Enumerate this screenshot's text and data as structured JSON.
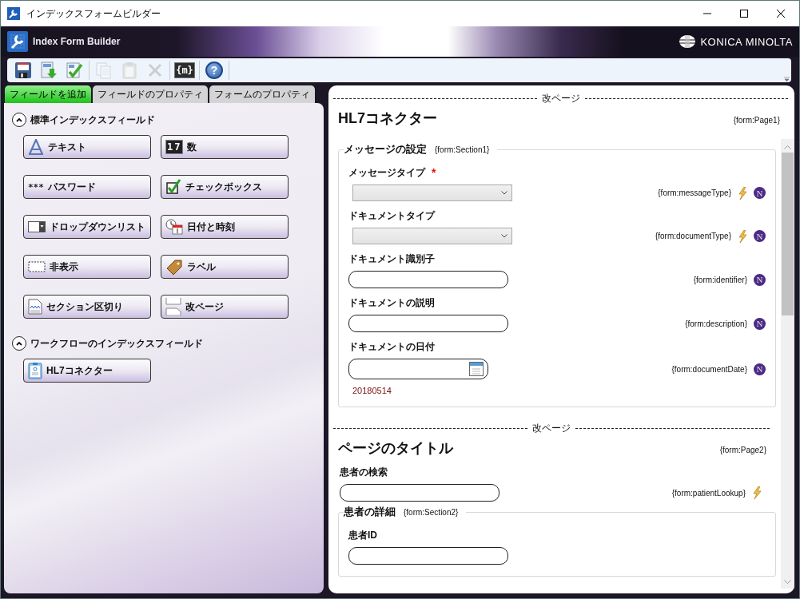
{
  "window": {
    "title": "インデックスフォームビルダー"
  },
  "banner": {
    "app_name": "Index Form Builder",
    "brand": "KONICA MINOLTA"
  },
  "toolbar": [
    {
      "kind": "save",
      "disabled": false
    },
    {
      "kind": "import",
      "disabled": false
    },
    {
      "kind": "validate",
      "disabled": false
    },
    {
      "kind": "separator"
    },
    {
      "kind": "copy",
      "disabled": true
    },
    {
      "kind": "paste",
      "disabled": true
    },
    {
      "kind": "delete",
      "disabled": true
    },
    {
      "kind": "separator"
    },
    {
      "kind": "macro",
      "text": "{m}",
      "disabled": false
    },
    {
      "kind": "separator"
    },
    {
      "kind": "help",
      "text": "?",
      "disabled": false
    },
    {
      "kind": "separator"
    }
  ],
  "tabs": [
    {
      "label": "フィールドを追加",
      "selected": true
    },
    {
      "label": "フィールドのプロパティ",
      "selected": false
    },
    {
      "label": "フォームのプロパティ",
      "selected": false
    }
  ],
  "palette": [
    {
      "title": "標準インデックスフィールド",
      "expanded": true,
      "buttons": [
        {
          "kind": "text",
          "label": "テキスト"
        },
        {
          "kind": "number",
          "label": "数",
          "icon_text": "17"
        },
        {
          "kind": "password",
          "label": "パスワード",
          "icon_text": "***"
        },
        {
          "kind": "checkbox",
          "label": "チェックボックス"
        },
        {
          "kind": "dropdown",
          "label": "ドロップダウンリスト"
        },
        {
          "kind": "datetime",
          "label": "日付と時刻"
        },
        {
          "kind": "hidden",
          "label": "非表示"
        },
        {
          "kind": "label",
          "label": "ラベル"
        },
        {
          "kind": "section",
          "label": "セクション区切り"
        },
        {
          "kind": "pagebreak",
          "label": "改ページ"
        }
      ]
    },
    {
      "title": "ワークフローのインデックスフィールド",
      "expanded": true,
      "buttons": [
        {
          "kind": "hl7",
          "label": "HL7コネクター"
        }
      ]
    }
  ],
  "pages": [
    {
      "break_label": "改ページ",
      "title": "HL7コネクター",
      "tag": "{form:Page1}",
      "content": [
        {
          "kind": "section",
          "title": "メッセージの設定",
          "tag": "{form:Section1}",
          "fields": [
            {
              "kind": "dropdown",
              "label": "メッセージタイプ",
              "required_mark": "*",
              "tag": "{form:messageType}",
              "lookup": true,
              "badge": "N"
            },
            {
              "kind": "dropdown",
              "label": "ドキュメントタイプ",
              "tag": "{form:documentType}",
              "lookup": true,
              "badge": "N"
            },
            {
              "kind": "text",
              "label": "ドキュメント識別子",
              "tag": "{form:identifier}",
              "badge": "N"
            },
            {
              "kind": "text",
              "label": "ドキュメントの説明",
              "tag": "{form:description}",
              "badge": "N"
            },
            {
              "kind": "date",
              "label": "ドキュメントの日付",
              "tag": "{form:documentDate}",
              "badge": "N",
              "note": "20180514"
            }
          ]
        }
      ]
    },
    {
      "break_label": "改ページ",
      "title": "ページのタイトル",
      "tag": "{form:Page2}",
      "content": [
        {
          "kind": "field",
          "field": {
            "kind": "text",
            "label": "患者の検索",
            "tag": "{form:patientLookup}",
            "lookup": true
          }
        },
        {
          "kind": "section",
          "title": "患者の詳細",
          "tag": "{form:Section2}",
          "fields": [
            {
              "kind": "text",
              "label": "患者ID"
            }
          ]
        }
      ]
    }
  ]
}
